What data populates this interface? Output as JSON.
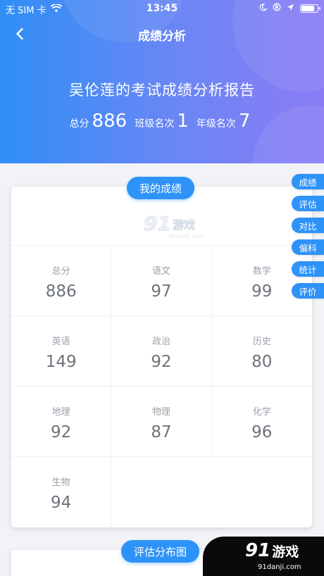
{
  "status": {
    "carrier": "无 SIM 卡",
    "time": "13:45",
    "battery_fraction": 0.85
  },
  "nav": {
    "title": "成绩分析"
  },
  "report": {
    "title": "吴伦莲的考试成绩分析报告",
    "total_label": "总分",
    "total_value": "886",
    "class_rank_label": "班级名次",
    "class_rank_value": "1",
    "grade_rank_label": "年级名次",
    "grade_rank_value": "7"
  },
  "side_tabs": [
    "成绩",
    "评估",
    "对比",
    "偏科",
    "统计",
    "评价"
  ],
  "my_scores": {
    "title": "我的成绩",
    "watermark": {
      "mark": "91",
      "name": "游戏",
      "url": "91danji.com"
    },
    "subjects": [
      {
        "label": "总分",
        "value": "886"
      },
      {
        "label": "语文",
        "value": "97"
      },
      {
        "label": "数学",
        "value": "99"
      },
      {
        "label": "英语",
        "value": "149"
      },
      {
        "label": "政治",
        "value": "92"
      },
      {
        "label": "历史",
        "value": "80"
      },
      {
        "label": "地理",
        "value": "92"
      },
      {
        "label": "物理",
        "value": "87"
      },
      {
        "label": "化学",
        "value": "96"
      },
      {
        "label": "生物",
        "value": "94"
      }
    ]
  },
  "distribution": {
    "title": "评估分布图"
  },
  "corner_logo": {
    "mark": "91",
    "name": "游戏",
    "url": "91danji.com"
  },
  "colors": {
    "accent": "#2e93f8",
    "header_start": "#2f8ff5",
    "header_end": "#8b7cf5"
  },
  "icons": [
    "wifi-icon",
    "moon-icon",
    "orientation-lock-icon",
    "location-arrow-icon",
    "battery-icon",
    "back-arrow-icon"
  ]
}
